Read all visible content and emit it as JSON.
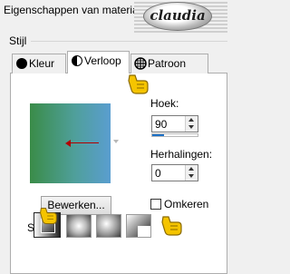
{
  "window": {
    "title": "Eigenschappen van materiaal"
  },
  "watermark": {
    "text": "claudia"
  },
  "group": {
    "label": "Stijl"
  },
  "tabs": [
    {
      "label": "Kleur",
      "icon": "black-circle-icon",
      "active": false
    },
    {
      "label": "Verloop",
      "icon": "half-circle-gradient-icon",
      "active": true
    },
    {
      "label": "Patroon",
      "icon": "grid-globe-icon",
      "active": false
    }
  ],
  "gradient": {
    "colors": [
      "#3a8c48",
      "#5a9ed0"
    ],
    "arrow_color": "#b00000"
  },
  "buttons": {
    "edit_label": "Bewerken..."
  },
  "fields": {
    "angle_label": "Hoek:",
    "angle_value": "90",
    "repeats_label": "Herhalingen:",
    "repeats_value": "0",
    "angle_slider_fraction": 0.25
  },
  "checkbox": {
    "label": "Omkeren",
    "checked": false
  },
  "style": {
    "label": "St",
    "buttons": [
      "linear-style-icon",
      "rectangular-style-icon",
      "sunburst-style-icon",
      "radial-style-icon"
    ],
    "selected_index": 0
  },
  "pointer_color": "#f5c400"
}
